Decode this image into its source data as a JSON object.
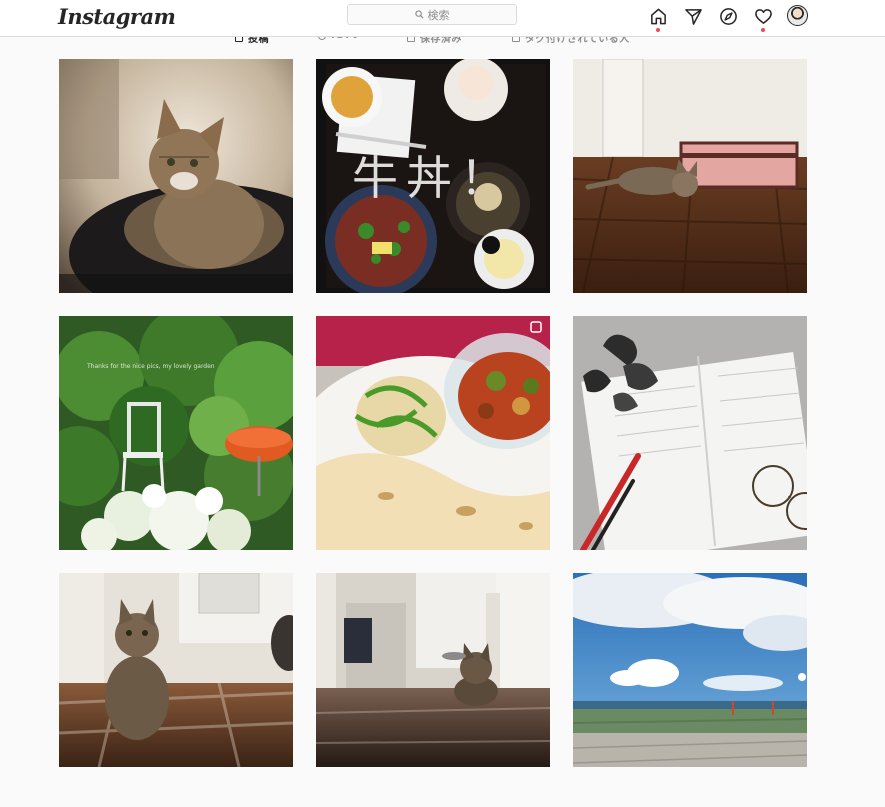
{
  "header": {
    "logo_text": "Instagram",
    "search_placeholder": "検索",
    "nav_icons": [
      "home-icon",
      "direct-icon",
      "explore-icon",
      "activity-heart-icon",
      "profile-avatar"
    ]
  },
  "tabs": [
    {
      "label": "投稿",
      "active": true
    },
    {
      "label": "IGTV",
      "active": false
    },
    {
      "label": "保存済み",
      "active": false
    },
    {
      "label": "タグ付けされている人",
      "active": false
    }
  ],
  "posts": [
    {
      "subject": "tabby cat on black cushion"
    },
    {
      "subject": "gyudon lunch tray",
      "overlay_text": "牛丼！"
    },
    {
      "subject": "cat lying on wooden floor by pink case"
    },
    {
      "subject": "garden with white chair",
      "overlay_text": "Thanks for the nice pics, my lovely garden"
    },
    {
      "subject": "curry with naan and salad"
    },
    {
      "subject": "open notebook with pens and glasses"
    },
    {
      "subject": "tabby cat sitting in hallway"
    },
    {
      "subject": "cat at end of corridor"
    },
    {
      "subject": "blue sky over seaside park"
    }
  ],
  "colors": {
    "accent_red": "#ed4956",
    "border": "#dbdbdb",
    "background": "#fafafa"
  }
}
